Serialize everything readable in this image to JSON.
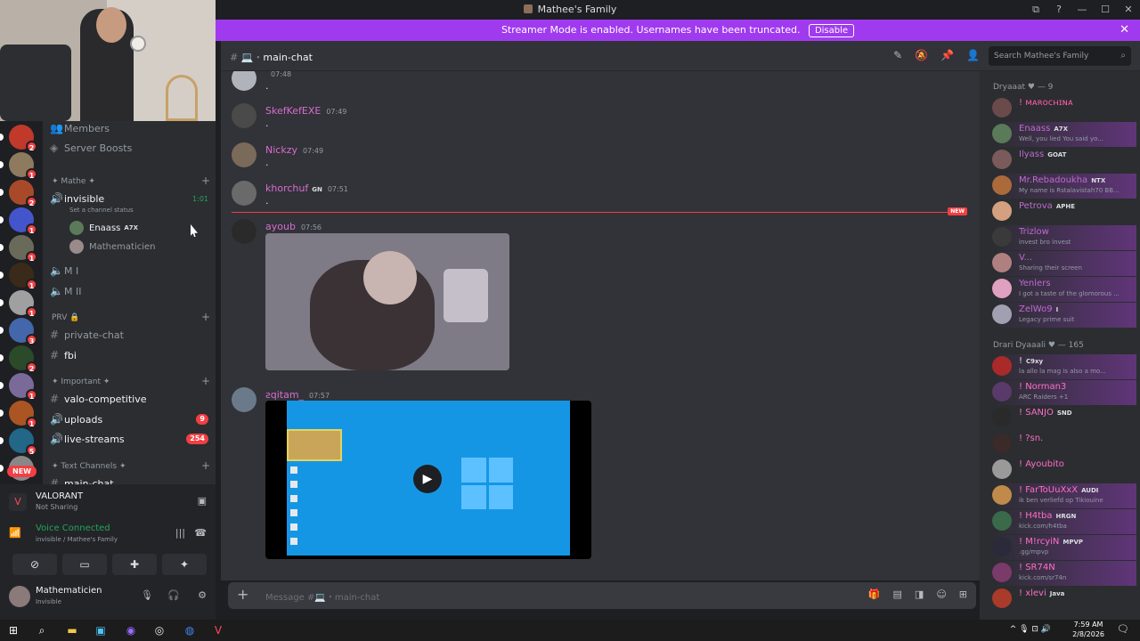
{
  "window": {
    "title": "Mathee's Family",
    "controls": [
      "⧉",
      "?",
      "—",
      "☐",
      "✕"
    ]
  },
  "streamer_banner": {
    "text": "Streamer Mode is enabled. Usernames have been truncated.",
    "button": "Disable",
    "close": "✕"
  },
  "servers": [
    {
      "badge": "2",
      "color": "#c0392b"
    },
    {
      "badge": "1",
      "color": "#8e7a5e"
    },
    {
      "badge": "2",
      "color": "#a84a2a"
    },
    {
      "badge": "1",
      "color": "#4455cc"
    },
    {
      "badge": "1",
      "color": "#6a6a5a"
    },
    {
      "badge": "1",
      "color": "#3a2a1a"
    },
    {
      "badge": "1",
      "color": "#a0a0a0"
    },
    {
      "badge": "3",
      "color": "#4466aa"
    },
    {
      "badge": "2",
      "color": "#2a4a2a"
    },
    {
      "badge": "1",
      "color": "#7a6a9a"
    },
    {
      "badge": "1",
      "color": "#aa5522"
    },
    {
      "badge": "5",
      "color": "#226688"
    },
    {
      "badge": "",
      "color": "#888888"
    }
  ],
  "new_pill": "NEW",
  "channels": {
    "members": "Members",
    "server_boosts": "Server Boosts",
    "cat_mathe": "✦ Mathe ✦",
    "invisible": "invisible",
    "invisible_timer": "1:01",
    "set_status": "Set a channel status",
    "voice_users": [
      {
        "name": "Enaass",
        "tag": "A7X"
      },
      {
        "name": "Mathematicien",
        "tag": ""
      }
    ],
    "m1": "M I",
    "m2": "M II",
    "cat_prv": "PRV 🔒",
    "private_chat": "private-chat",
    "fbi": "fbi",
    "cat_important": "✦ Important ✦",
    "valo": "valo-competitive",
    "uploads": "uploads",
    "uploads_badge": "9",
    "live": "live-streams",
    "live_badge": "254",
    "cat_text": "✦ Text Channels ✦",
    "main_chat": "main-chat"
  },
  "voice_panel": {
    "game": "VALORANT",
    "game_status": "Not Sharing",
    "connected": "Voice Connected",
    "connected_detail": "invisible / Mathee's Family",
    "user": "Mathematicien",
    "user_status": "Invisible"
  },
  "chat_header": {
    "channel": "main-chat",
    "search_placeholder": "Search Mathee's Family"
  },
  "messages": [
    {
      "author": "",
      "time": "07:48",
      "body": ".",
      "color": "#d96bd0"
    },
    {
      "author": "SkefKefEXE",
      "time": "07:49",
      "body": ".",
      "color": "#d96bd0"
    },
    {
      "author": "Nickzy",
      "time": "07:49",
      "body": ".",
      "color": "#d96bd0"
    },
    {
      "author": "khorchuf",
      "time": "07:51",
      "tag": "GN",
      "body": ".",
      "color": "#d96bd0"
    },
    {
      "author": "ayoub",
      "time": "07:56",
      "body": "",
      "color": "#d96bd0"
    },
    {
      "author": "ƨqitam_",
      "time": "07:57",
      "body": "",
      "color": "#d96bd0"
    }
  ],
  "new_label": "NEW",
  "composer": {
    "placeholder": "Message #💻・main-chat"
  },
  "members": {
    "cat1": "Dryaaat ♥ — 9",
    "cat2": "Drari Dyaaali ♥ — 165",
    "list1": [
      {
        "name": "! ᴍᴀʀᴏᴄʜɪɴᴀ",
        "status": "",
        "color": "#ff5ba8",
        "av": "#6a4a4a"
      },
      {
        "name": "Enaass",
        "tag": "A7X",
        "status": "Well, you lied You said yo...",
        "color": "#c06ad0",
        "av": "#5a7a5a"
      },
      {
        "name": "Ilyass",
        "tag": "GOAT",
        "status": "",
        "color": "#c06ad0",
        "av": "#7a5a5a"
      },
      {
        "name": "Mr.Rebadoukha",
        "tag": "NTX",
        "status": "My name is Rstalavistah70 BB...",
        "color": "#c06ad0",
        "av": "#aa6a3a"
      },
      {
        "name": "Petrova",
        "tag": "APHE",
        "status": "",
        "color": "#c06ad0",
        "av": "#d4a080"
      },
      {
        "name": "Trizlow",
        "status": "invest bro invest",
        "color": "#c06ad0",
        "av": "#3a3a3a"
      },
      {
        "name": "V...",
        "status": "Sharing their screen",
        "color": "#c06ad0",
        "av": "#b08080"
      },
      {
        "name": "Yenlers",
        "status": "I got a taste of the glomorous ...",
        "color": "#c06ad0",
        "av": "#e0a0c0"
      },
      {
        "name": "ZelWo9",
        "tag": "I",
        "status": "Legacy prime suit",
        "color": "#c06ad0",
        "av": "#a0a0b0"
      }
    ],
    "list2": [
      {
        "name": "!",
        "tag": "C9xy",
        "status": "la allo la mag is also a mo...",
        "color": "#e0e0e0",
        "av": "#aa2a2a"
      },
      {
        "name": "! Norman3",
        "status": "ARC Raiders +1",
        "color": "#ff6ec7",
        "av": "#5a3a6a"
      },
      {
        "name": "! SANJO",
        "tag": "SND",
        "status": "",
        "color": "#ff6ec7",
        "av": "#2a2a2a"
      },
      {
        "name": "! ?sn.",
        "status": "",
        "color": "#ff6ec7",
        "av": "#3a2a2a"
      },
      {
        "name": "! Ayoubito",
        "status": "",
        "color": "#ff6ec7",
        "av": "#9a9a9a"
      },
      {
        "name": "! FarToUuXxX",
        "tag": "AUDI",
        "status": "ik ben verliefd op Tikiouine",
        "color": "#ff6ec7",
        "av": "#c08a4a"
      },
      {
        "name": "! H4tba",
        "tag": "HRGN",
        "status": "kick.com/h4tba",
        "color": "#ff6ec7",
        "av": "#3a6a4a"
      },
      {
        "name": "! M!rcyiN",
        "tag": "MPVP",
        "status": ".gg/mpvp",
        "color": "#ff6ec7",
        "av": "#2a2a3a"
      },
      {
        "name": "! SR74N",
        "status": "kick.com/sr74n",
        "color": "#ff6ec7",
        "av": "#7a3a6a"
      },
      {
        "name": "! xlevi",
        "tag": "Java",
        "status": "",
        "color": "#ff6ec7",
        "av": "#aa3a2a"
      }
    ]
  },
  "taskbar": {
    "time": "7:59 AM",
    "date": "2/8/2026"
  }
}
